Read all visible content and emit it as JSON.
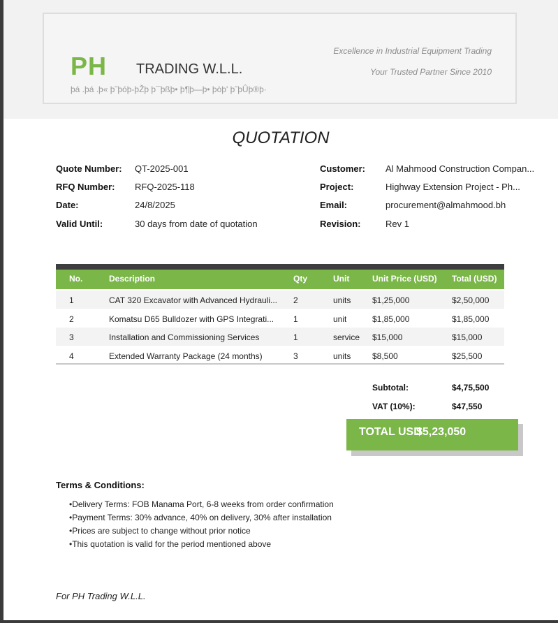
{
  "header": {
    "logo_text": "PH",
    "company_name": "TRADING W.L.L.",
    "arabic_name": "þá .þá .þ« þ˜þóþ-þŽþ þ¯þßþ• þ¶þ—þ• þòþ' þ˜þÛþ®þ·",
    "tagline_1": "Excellence in Industrial Equipment Trading",
    "tagline_2": "Your Trusted Partner Since 2010"
  },
  "document": {
    "title": "QUOTATION"
  },
  "quote_info": {
    "left": [
      {
        "label": "Quote Number:",
        "value": "QT-2025-001"
      },
      {
        "label": "RFQ Number:",
        "value": "RFQ-2025-118"
      },
      {
        "label": "Date:",
        "value": "24/8/2025"
      },
      {
        "label": "Valid Until:",
        "value": "30 days from date of quotation"
      }
    ],
    "right": [
      {
        "label": "Customer:",
        "value": "Al Mahmood Construction Compan..."
      },
      {
        "label": "Project:",
        "value": "Highway Extension Project - Ph..."
      },
      {
        "label": "Email:",
        "value": "procurement@almahmood.bh"
      },
      {
        "label": "Revision:",
        "value": "Rev 1"
      }
    ]
  },
  "items_table": {
    "headers": [
      "No.",
      "Description",
      "Qty",
      "Unit",
      "Unit Price (USD)",
      "Total (USD)"
    ],
    "rows": [
      [
        "1",
        "CAT 320 Excavator with Advanced Hydrauli...",
        "2",
        "units",
        "$1,25,000",
        "$2,50,000"
      ],
      [
        "2",
        "Komatsu D65 Bulldozer with GPS Integrati...",
        "1",
        "unit",
        "$1,85,000",
        "$1,85,000"
      ],
      [
        "3",
        "Installation and Commissioning Services",
        "1",
        "service",
        "$15,000",
        "$15,000"
      ],
      [
        "4",
        "Extended Warranty Package (24 months)",
        "3",
        "units",
        "$8,500",
        "$25,500"
      ]
    ]
  },
  "summary": {
    "subtotal_label": "Subtotal:",
    "subtotal_value": "$4,75,500",
    "vat_label": "VAT (10%):",
    "vat_value": "$47,550",
    "total_label": "TOTAL USD",
    "total_value": "$5,23,050"
  },
  "terms": {
    "title": "Terms & Conditions:",
    "items": [
      "Delivery Terms: FOB Manama Port, 6-8 weeks from order confirmation",
      "Payment Terms: 30% advance, 40% on delivery, 30% after installation",
      "Prices are subject to change without prior notice",
      "This quotation is valid for the period mentioned above"
    ]
  },
  "footer": {
    "signoff": "For PH Trading W.L.L."
  },
  "colors": {
    "brand_green": "#7ab648",
    "dark_bar": "#3e3e3e",
    "row_alt": "#f3f3f3"
  }
}
